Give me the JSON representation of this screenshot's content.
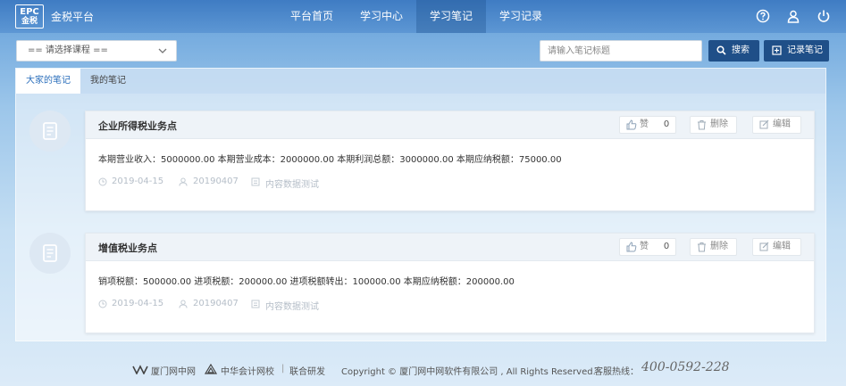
{
  "header": {
    "logo_line1": "EPC",
    "logo_line2": "金税",
    "brand": "金税平台",
    "nav": [
      {
        "label": "平台首页"
      },
      {
        "label": "学习中心"
      },
      {
        "label": "学习笔记",
        "active": true
      },
      {
        "label": "学习记录"
      }
    ],
    "icons": [
      "help-icon",
      "user-icon",
      "power-icon"
    ]
  },
  "toolbar": {
    "course_select": "== 请选择课程 ==",
    "search_placeholder": "请输入笔记标题",
    "search_button": "搜索",
    "record_button": "记录笔记"
  },
  "tabs": [
    {
      "label": "大家的笔记",
      "active": true
    },
    {
      "label": "我的笔记"
    }
  ],
  "notes": [
    {
      "title": "企业所得税业务点",
      "like_label": "赞",
      "like_count": "0",
      "delete_label": "删除",
      "edit_label": "编辑",
      "content": "本期营业收入：5000000.00 本期营业成本：2000000.00 本期利润总额：3000000.00 本期应纳税额：75000.00",
      "date": "2019-04-15",
      "user": "20190407",
      "course": "内容数据测试"
    },
    {
      "title": "增值税业务点",
      "like_label": "赞",
      "like_count": "0",
      "delete_label": "删除",
      "edit_label": "编辑",
      "content": "销项税额：500000.00 进项税额：200000.00 进项税额转出：100000.00 本期应纳税额：200000.00",
      "date": "2019-04-15",
      "user": "20190407",
      "course": "内容数据测试"
    }
  ],
  "footer": {
    "partner1": "厦门网中网",
    "partner2": "中华会计网校",
    "joint": "联合研发",
    "copyright": "Copyright © 厦门网中网软件有限公司 , All Rights Reserved.",
    "hotline_label": "客服热线：",
    "hotline": "400-0592-228"
  },
  "colors": {
    "header": "#4a86c8",
    "button_dark": "#1f4f88",
    "active_tab_text": "#2a6ebb"
  }
}
